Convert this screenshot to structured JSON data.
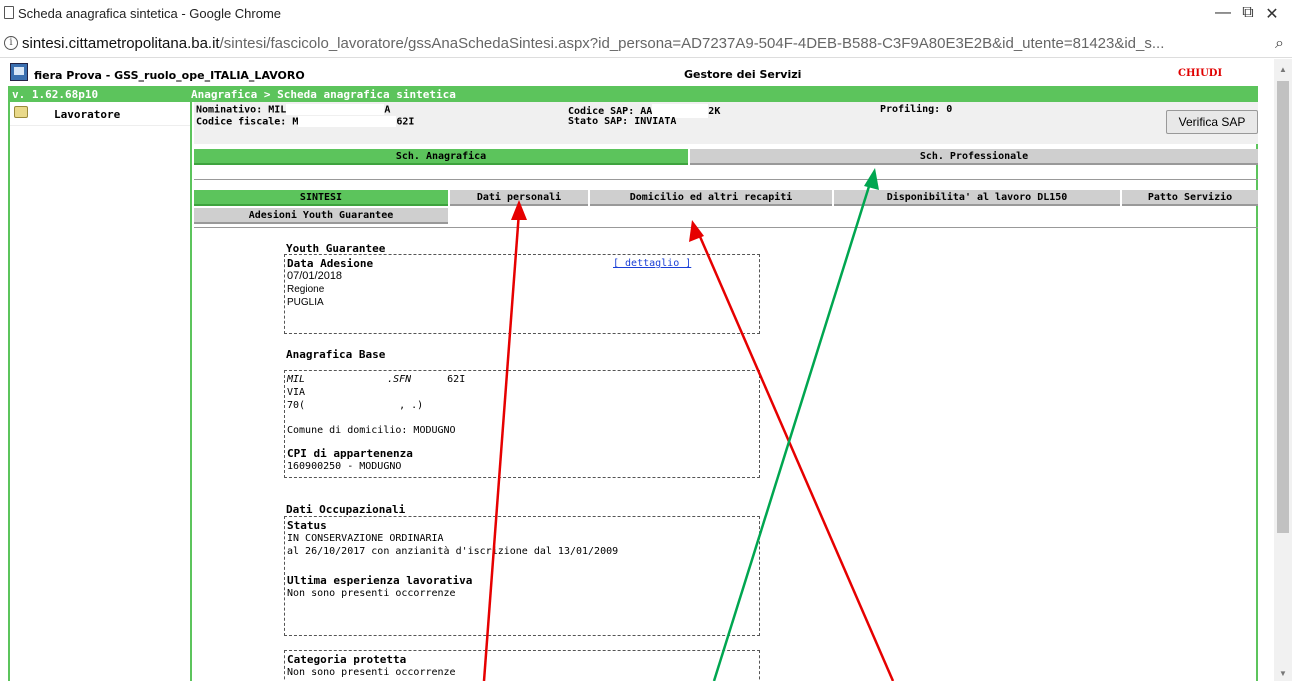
{
  "window": {
    "title": "Scheda anagrafica sintetica - Google Chrome",
    "minimize": "—",
    "restore": "⧉",
    "close": "✕"
  },
  "address": {
    "host": "sintesi.cittametropolitana.ba.it",
    "path": "/sintesi/fascicolo_lavoratore/gssAnaSchedaSintesi.aspx?id_persona=AD7237A9-504F-4DEB-B588-C3F9A80E3E2B&id_utente=81423&id_s..."
  },
  "app": {
    "name": "fiera Prova - GSS_ruolo_ope_ITALIA_LAVORO",
    "service_title": "Gestore dei Servizi",
    "close_label": "CHIUDI",
    "version": "v. 1.62.68p10",
    "breadcrumb": "Anagrafica > Scheda anagrafica sintetica"
  },
  "sidebar": {
    "worker_label": "Lavoratore"
  },
  "info": {
    "nominativo_label": "Nominativo: MIL",
    "nominativo_suffix": "A",
    "codice_fiscale_label": "Codice fiscale: M",
    "codice_fiscale_suffix": "62I",
    "codice_sap_label": "Codice SAP: AA",
    "codice_sap_suffix": "2K",
    "stato_sap": "Stato SAP: INVIATA",
    "profiling": "Profiling: 0",
    "verifica_button": "Verifica SAP"
  },
  "main_tabs": [
    {
      "label": "Sch. Anagrafica",
      "active": true
    },
    {
      "label": "Sch. Professionale",
      "active": false
    }
  ],
  "sub_tabs": [
    {
      "label": "SINTESI",
      "active": true
    },
    {
      "label": "Dati personali",
      "active": false
    },
    {
      "label": "Domicilio ed altri recapiti",
      "active": false
    },
    {
      "label": "Disponibilita' al lavoro DL150",
      "active": false
    },
    {
      "label": "Patto Servizio",
      "active": false
    },
    {
      "label": "Adesioni Youth Guarantee",
      "active": false
    }
  ],
  "youth": {
    "title": "Youth Guarantee",
    "data_label": "Data Adesione",
    "date": "07/01/2018",
    "dettaglio": "[ dettaglio ]",
    "regione_label": "Regione",
    "regione": "PUGLIA"
  },
  "anagrafica": {
    "title": "Anagrafica Base",
    "line1_a": "MIL",
    "line1_b": ".SFN",
    "line1_c": "62I",
    "line2": "VIA",
    "line3_a": "70(",
    "line3_b": ", .)",
    "comune": "Comune di domicilio: MODUGNO",
    "cpi_label": "CPI di appartenenza",
    "cpi": "160900250 - MODUGNO"
  },
  "occupazionali": {
    "title": "Dati Occupazionali",
    "status_label": "Status",
    "status": "IN CONSERVAZIONE ORDINARIA",
    "status_detail": "al 26/10/2017 con anzianità d'iscrizione dal 13/01/2009",
    "esperienza_label": "Ultima esperienza lavorativa",
    "esperienza": "Non sono presenti occorrenze"
  },
  "protetta": {
    "label": "Categoria protetta",
    "value": "Non sono presenti occorrenze"
  },
  "colors": {
    "accent_green": "#5cc45c",
    "arrow_red": "#e60000",
    "arrow_green": "#00a650",
    "close_red": "#e00000"
  }
}
